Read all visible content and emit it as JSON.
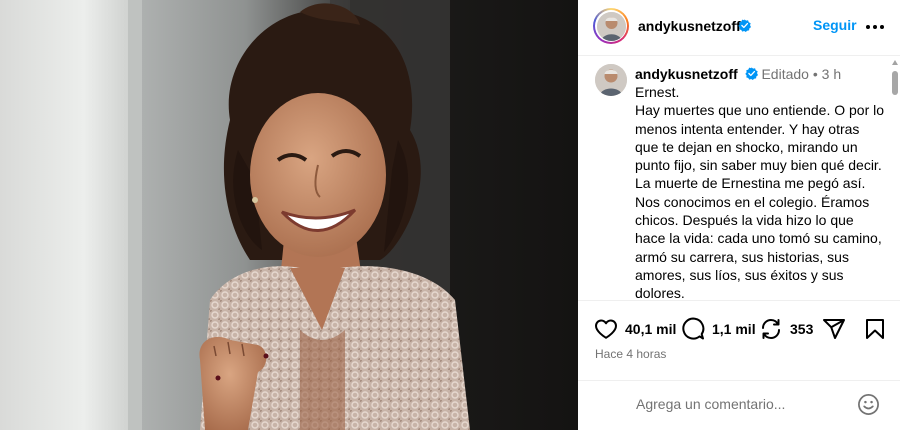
{
  "post": {
    "username": "andykusnetzoff",
    "verified": true,
    "follow_label": "Seguir",
    "more_icon": "more-horizontal-icon"
  },
  "caption": {
    "username": "andykusnetzoff",
    "edited_label": "Editado",
    "separator": "•",
    "time_short": "3 h",
    "text": "Ernest.\nHay muertes que uno entiende. O por lo menos intenta entender. Y hay otras que te dejan en shocko, mirando un punto fijo, sin saber muy bien qué decir.\nLa muerte de Ernestina me pegó así.\nNos conocimos en el colegio. Éramos chicos. Después la vida hizo lo que hace la vida: cada uno tomó su camino, armó su carrera, sus historias, sus amores, sus líos, sus éxitos y sus dolores.\nPero hay personas con las que nunca perdés del todo el hilo. Porque son de"
  },
  "actions": {
    "likes": "40,1 mil",
    "comments": "1,1 mil",
    "reposts": "353",
    "icons": [
      "heart-icon",
      "comment-icon",
      "repost-icon",
      "share-icon",
      "bookmark-icon"
    ],
    "time_ago": "Hace 4 horas"
  },
  "comment": {
    "placeholder": "Agrega un comentario...",
    "emoji_icon": "emoji-icon"
  },
  "colors": {
    "accent": "#0095f6",
    "verified": "#0095f6",
    "secondary_text": "#737373",
    "divider": "#efefef"
  }
}
